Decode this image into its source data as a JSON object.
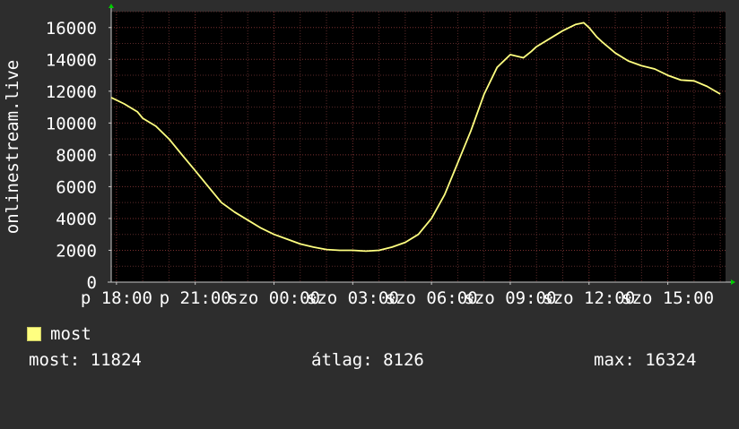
{
  "chart_data": {
    "type": "line",
    "ylabel": "onlinestream.live",
    "ylim": [
      0,
      17000
    ],
    "y_ticks": [
      0,
      2000,
      4000,
      6000,
      8000,
      10000,
      12000,
      14000,
      16000
    ],
    "x_tick_labels": [
      "p 18:00",
      "p 21:00",
      "szo 00:00",
      "szo 03:00",
      "szo 06:00",
      "szo 09:00",
      "szo 12:00",
      "szo 15:00"
    ],
    "x_ticks_hours": [
      0,
      3,
      6,
      9,
      12,
      15,
      18,
      21
    ],
    "xlim_hours": [
      -0.2,
      23.2
    ],
    "grid": true,
    "colors": {
      "background": "#2d2d2d",
      "plot_bg": "#000000",
      "grid": "#5a2a2a",
      "line": "#ffff80",
      "axis": "#c8c8c8",
      "arrow": "#00cc00"
    },
    "series": [
      {
        "name": "most",
        "x": [
          -0.2,
          0.3,
          0.8,
          1.0,
          1.5,
          2.0,
          2.5,
          3.0,
          3.5,
          4.0,
          4.5,
          5.0,
          5.5,
          6.0,
          6.5,
          7.0,
          7.5,
          8.0,
          8.5,
          9.0,
          9.5,
          10.0,
          10.5,
          11.0,
          11.5,
          12.0,
          12.5,
          13.0,
          13.5,
          14.0,
          14.5,
          15.0,
          15.5,
          15.8,
          16.0,
          16.5,
          17.0,
          17.5,
          17.8,
          18.0,
          18.3,
          18.5,
          19.0,
          19.5,
          20.0,
          20.5,
          21.0,
          21.5,
          22.0,
          22.5,
          23.0
        ],
        "y": [
          11600,
          11200,
          10700,
          10300,
          9800,
          9000,
          8000,
          7000,
          6000,
          5000,
          4400,
          3900,
          3400,
          3000,
          2700,
          2400,
          2200,
          2050,
          2000,
          2000,
          1950,
          2000,
          2200,
          2500,
          3000,
          4000,
          5500,
          7500,
          9500,
          11800,
          13500,
          14300,
          14100,
          14500,
          14800,
          15300,
          15800,
          16200,
          16300,
          16000,
          15400,
          15100,
          14400,
          13900,
          13600,
          13400,
          13000,
          12700,
          12650,
          12300,
          11824
        ]
      }
    ],
    "legend": {
      "label": "most",
      "position": "bottom-left"
    }
  },
  "stats": {
    "current": "most: 11824",
    "average": "átlag: 8126",
    "maximum": "max: 16324"
  }
}
